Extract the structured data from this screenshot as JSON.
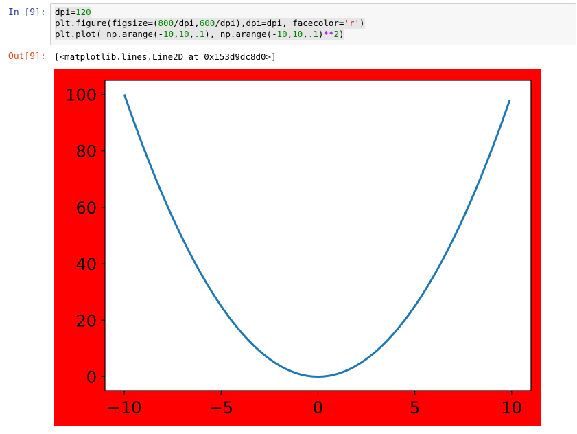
{
  "notebook": {
    "input_prompt": "In [9]:",
    "output_prompt": "Out[9]:",
    "output_text": "[<matplotlib.lines.Line2D at 0x153d9dc8d0>]"
  },
  "code_lines": [
    [
      {
        "t": "dpi=",
        "c": ""
      },
      {
        "t": "120",
        "c": "num"
      }
    ],
    [
      {
        "t": "plt.figure(figsize=(",
        "c": ""
      },
      {
        "t": "800",
        "c": "num"
      },
      {
        "t": "/dpi,",
        "c": ""
      },
      {
        "t": "600",
        "c": "num"
      },
      {
        "t": "/dpi),dpi=dpi, facecolor=",
        "c": ""
      },
      {
        "t": "'r'",
        "c": "str"
      },
      {
        "t": ")",
        "c": ""
      }
    ],
    [
      {
        "t": "plt.plot( np.arange(-",
        "c": ""
      },
      {
        "t": "10",
        "c": "num"
      },
      {
        "t": ",",
        "c": ""
      },
      {
        "t": "10",
        "c": "num"
      },
      {
        "t": ",",
        "c": ""
      },
      {
        "t": ".1",
        "c": "num"
      },
      {
        "t": "), np.arange(-",
        "c": ""
      },
      {
        "t": "10",
        "c": "num"
      },
      {
        "t": ",",
        "c": ""
      },
      {
        "t": "10",
        "c": "num"
      },
      {
        "t": ",",
        "c": ""
      },
      {
        "t": ".1",
        "c": "num"
      },
      {
        "t": ")",
        "c": ""
      },
      {
        "t": "**",
        "c": "op"
      },
      {
        "t": "2",
        "c": "num"
      },
      {
        "t": ")",
        "c": ""
      }
    ]
  ],
  "chart_data": {
    "type": "line",
    "title": "",
    "xlabel": "",
    "ylabel": "",
    "facecolor": "#ff0000",
    "axes_facecolor": "#ffffff",
    "line_color": "#1f77b4",
    "grid": false,
    "xlim": [
      -11,
      11
    ],
    "ylim": [
      -5,
      105
    ],
    "xticks": [
      -10,
      -5,
      0,
      5,
      10
    ],
    "xtick_labels": [
      "−10",
      "−5",
      "0",
      "5",
      "10"
    ],
    "yticks": [
      0,
      20,
      40,
      60,
      80,
      100
    ],
    "ytick_labels": [
      "0",
      "20",
      "40",
      "60",
      "80",
      "100"
    ],
    "series": [
      {
        "x": [
          -10,
          -9,
          -8,
          -7,
          -6,
          -5,
          -4,
          -3,
          -2,
          -1,
          0,
          1,
          2,
          3,
          4,
          5,
          6,
          7,
          8,
          9,
          9.9
        ],
        "y": [
          100,
          81,
          64,
          49,
          36,
          25,
          16,
          9,
          4,
          1,
          0,
          1,
          4,
          9,
          16,
          25,
          36,
          49,
          64,
          81,
          98.01
        ]
      }
    ]
  }
}
